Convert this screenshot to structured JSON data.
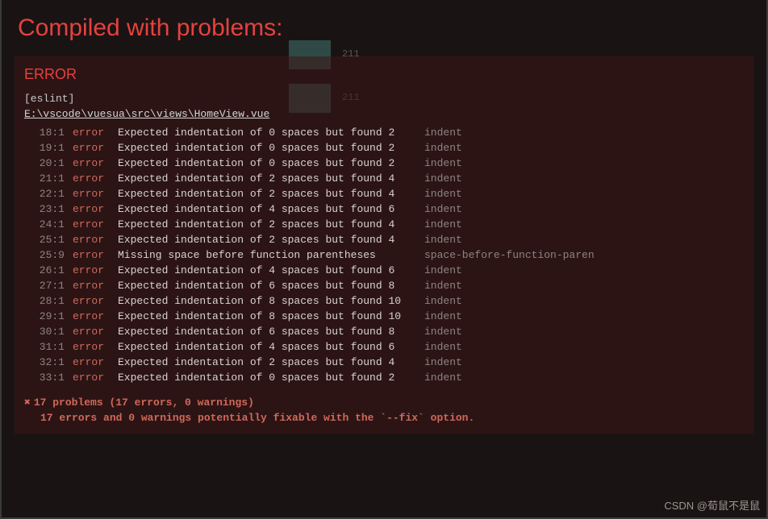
{
  "title": "Compiled with problems:",
  "error_heading": "ERROR",
  "eslint_label": "[eslint]",
  "file_path": "E:\\vscode\\vuesua\\src\\views\\HomeView.vue",
  "ghost": {
    "btn1_val": "211",
    "btn2_val": "211"
  },
  "errors": [
    {
      "loc": "18:1",
      "sev": "error",
      "msg": "Expected indentation of 0 spaces but found 2",
      "rule": "indent"
    },
    {
      "loc": "19:1",
      "sev": "error",
      "msg": "Expected indentation of 0 spaces but found 2",
      "rule": "indent"
    },
    {
      "loc": "20:1",
      "sev": "error",
      "msg": "Expected indentation of 0 spaces but found 2",
      "rule": "indent"
    },
    {
      "loc": "21:1",
      "sev": "error",
      "msg": "Expected indentation of 2 spaces but found 4",
      "rule": "indent"
    },
    {
      "loc": "22:1",
      "sev": "error",
      "msg": "Expected indentation of 2 spaces but found 4",
      "rule": "indent"
    },
    {
      "loc": "23:1",
      "sev": "error",
      "msg": "Expected indentation of 4 spaces but found 6",
      "rule": "indent"
    },
    {
      "loc": "24:1",
      "sev": "error",
      "msg": "Expected indentation of 2 spaces but found 4",
      "rule": "indent"
    },
    {
      "loc": "25:1",
      "sev": "error",
      "msg": "Expected indentation of 2 spaces but found 4",
      "rule": "indent"
    },
    {
      "loc": "25:9",
      "sev": "error",
      "msg": "Missing space before function parentheses",
      "rule": "space-before-function-paren"
    },
    {
      "loc": "26:1",
      "sev": "error",
      "msg": "Expected indentation of 4 spaces but found 6",
      "rule": "indent"
    },
    {
      "loc": "27:1",
      "sev": "error",
      "msg": "Expected indentation of 6 spaces but found 8",
      "rule": "indent"
    },
    {
      "loc": "28:1",
      "sev": "error",
      "msg": "Expected indentation of 8 spaces but found 10",
      "rule": "indent"
    },
    {
      "loc": "29:1",
      "sev": "error",
      "msg": "Expected indentation of 8 spaces but found 10",
      "rule": "indent"
    },
    {
      "loc": "30:1",
      "sev": "error",
      "msg": "Expected indentation of 6 spaces but found 8",
      "rule": "indent"
    },
    {
      "loc": "31:1",
      "sev": "error",
      "msg": "Expected indentation of 4 spaces but found 6",
      "rule": "indent"
    },
    {
      "loc": "32:1",
      "sev": "error",
      "msg": "Expected indentation of 2 spaces but found 4",
      "rule": "indent"
    },
    {
      "loc": "33:1",
      "sev": "error",
      "msg": "Expected indentation of 0 spaces but found 2",
      "rule": "indent"
    }
  ],
  "summary_line1": "17 problems (17 errors, 0 warnings)",
  "summary_x": "✖",
  "summary_line2": "17 errors and 0 warnings potentially fixable with the `--fix` option.",
  "watermark": "CSDN @荀鼠不是鼠"
}
